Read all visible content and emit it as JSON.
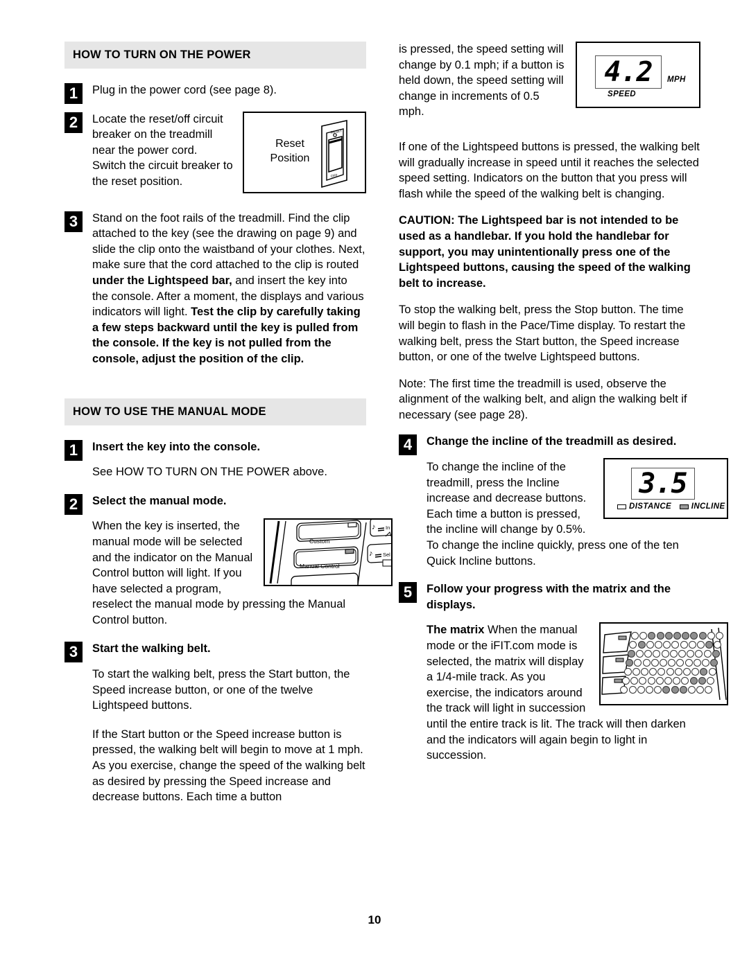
{
  "page_number": "10",
  "colors": {
    "band": "#e6e6e6",
    "ink": "#000000",
    "led_on": "#8e8e8e"
  },
  "left_column": {
    "section1": {
      "heading": "HOW TO TURN ON THE POWER",
      "steps": [
        {
          "num": "1",
          "text": "Plug in the power cord (see page 8)."
        },
        {
          "num": "2",
          "text": "Locate the reset/off circuit breaker on the treadmill near the power cord. Switch the circuit breaker to the reset position."
        },
        {
          "num": "3",
          "text_part1": "Stand on the foot rails of the treadmill. Find the clip attached to the key (see the drawing on page 9) and slide the clip onto the waistband of your clothes. Next, make sure that the cord attached to the clip is routed ",
          "bold1": "under the Lightspeed bar,",
          "text_part2": " and insert the key into the console. After a moment, the displays and various indicators will light. ",
          "bold2": "Test the clip by carefully taking a few steps backward until the key is pulled from the console. If the key is not pulled from the console, adjust the position of the clip."
        }
      ],
      "breaker_figure": {
        "label_line1": "Reset",
        "label_line2": "Position"
      }
    },
    "section2": {
      "heading": "HOW TO USE THE MANUAL MODE",
      "step1": {
        "num": "1",
        "title": "Insert the key into the console.",
        "body": "See HOW TO TURN ON THE POWER above."
      },
      "step2": {
        "num": "2",
        "title": "Select the manual mode.",
        "body_wrap": "When the key is inserted, the manual mode will be selected and the indicator on the Manual Control button will light. If you have selected a program, reselect the manual mode by pressing the Manual Control button."
      },
      "console_figure": {
        "button1": "Custom",
        "button2": "Manual Control"
      },
      "step3": {
        "num": "3",
        "title": "Start the walking belt.",
        "body1": "To start the walking belt, press the Start button, the Speed increase button, or one of the twelve Lightspeed buttons.",
        "body2": "If the Start button or the Speed increase button is pressed, the walking belt will begin to move at 1 mph. As you exercise, change the speed of the walking belt as desired by pressing the Speed increase and decrease buttons. Each time a button"
      }
    }
  },
  "right_column": {
    "continuation": "is pressed, the speed setting will change by 0.1 mph; if a button is held down, the speed setting will change in increments of 0.5 mph.",
    "speed_figure": {
      "value": "4.2",
      "unit": "MPH",
      "caption": "SPEED"
    },
    "para_lightspeed": "If one of the Lightspeed buttons is pressed, the walking belt will gradually increase in speed until it reaches the selected speed setting. Indicators on the button that you press will flash while the speed of the walking belt is changing.",
    "caution": "CAUTION: The Lightspeed bar is not intended to be used as a handlebar. If you hold the handlebar for support, you may unintentionally press one of the Lightspeed buttons, causing the speed of the walking belt to increase.",
    "para_stop": "To stop the walking belt, press the Stop button. The time will begin to flash in the Pace/Time display. To restart the walking belt, press the Start button, the Speed increase button, or one of the twelve Lightspeed buttons.",
    "para_note": "Note: The first time the treadmill is used, observe the alignment of the walking belt, and align the walking belt if necessary (see page 28).",
    "step4": {
      "num": "4",
      "title": "Change the incline of the treadmill as desired.",
      "body": "To change the incline of the treadmill, press the Incline increase and decrease buttons. Each time a button is pressed, the incline will change by 0.5%. To change the incline quickly, press one of the ten Quick Incline buttons."
    },
    "incline_figure": {
      "value": "3.5",
      "caption_distance": "DISTANCE",
      "caption_incline": "INCLINE"
    },
    "step5": {
      "num": "5",
      "title": "Follow your progress with the matrix and the displays.",
      "body_bold": "The matrix",
      "body": " When the manual mode or the iFIT.com mode is selected, the matrix will display a 1/4-mile track. As you exercise, the indicators around the track will light in succession until the entire track is lit. The track will then darken and the indicators will again begin to light in succession."
    }
  },
  "matrix_dots": {
    "rows": 7,
    "cols": 11,
    "on": [
      [
        0,
        0,
        1,
        1,
        1,
        1,
        1,
        1,
        1,
        0,
        0
      ],
      [
        0,
        1,
        0,
        0,
        0,
        0,
        0,
        0,
        0,
        1,
        0
      ],
      [
        1,
        0,
        0,
        0,
        0,
        0,
        0,
        0,
        0,
        0,
        1
      ],
      [
        1,
        0,
        0,
        0,
        0,
        0,
        0,
        0,
        0,
        0,
        1
      ],
      [
        0,
        0,
        0,
        0,
        0,
        0,
        0,
        0,
        0,
        1,
        0
      ],
      [
        0,
        0,
        0,
        0,
        0,
        0,
        0,
        0,
        1,
        1,
        0
      ],
      [
        0,
        0,
        0,
        0,
        0,
        1,
        1,
        1,
        0,
        0,
        0
      ]
    ]
  }
}
